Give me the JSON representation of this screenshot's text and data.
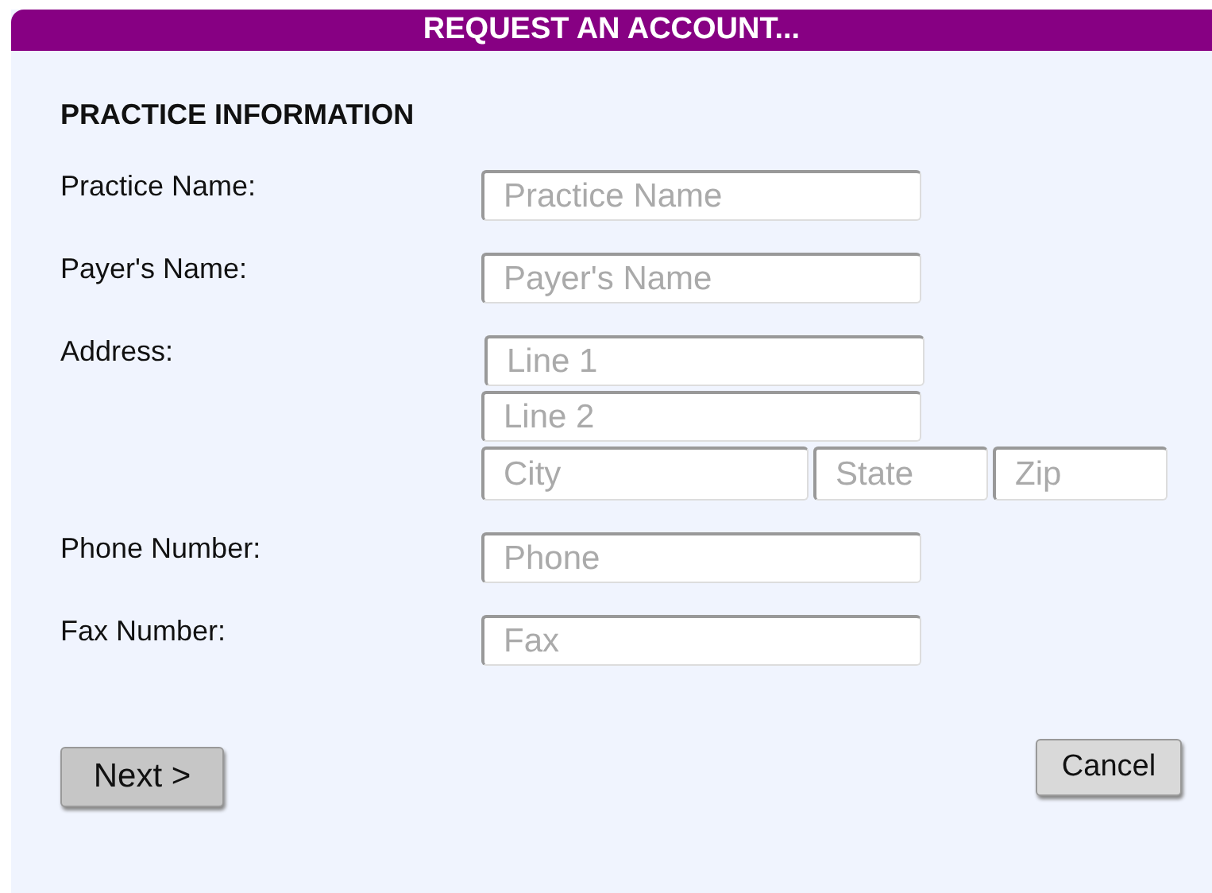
{
  "header": {
    "title": "REQUEST AN ACCOUNT..."
  },
  "section_title": "PRACTICE INFORMATION",
  "fields": [
    {
      "kind": "single",
      "label": "Practice Name:",
      "inputs": [
        {
          "placeholder": "Practice Name"
        }
      ]
    },
    {
      "kind": "single",
      "label": "Payer's Name:",
      "inputs": [
        {
          "placeholder": "Payer's Name"
        }
      ]
    },
    {
      "kind": "address",
      "label": "Address:",
      "inputs": [
        {
          "placeholder": "Line 1"
        },
        {
          "placeholder": "Line 2"
        },
        {
          "placeholder": "City"
        },
        {
          "placeholder": "State"
        },
        {
          "placeholder": "Zip"
        }
      ]
    },
    {
      "kind": "single",
      "label": "Phone Number:",
      "inputs": [
        {
          "placeholder": "Phone"
        }
      ]
    },
    {
      "kind": "single",
      "label": "Fax Number:",
      "inputs": [
        {
          "placeholder": "Fax"
        }
      ]
    }
  ],
  "buttons": {
    "next": "Next >",
    "cancel": "Cancel"
  }
}
